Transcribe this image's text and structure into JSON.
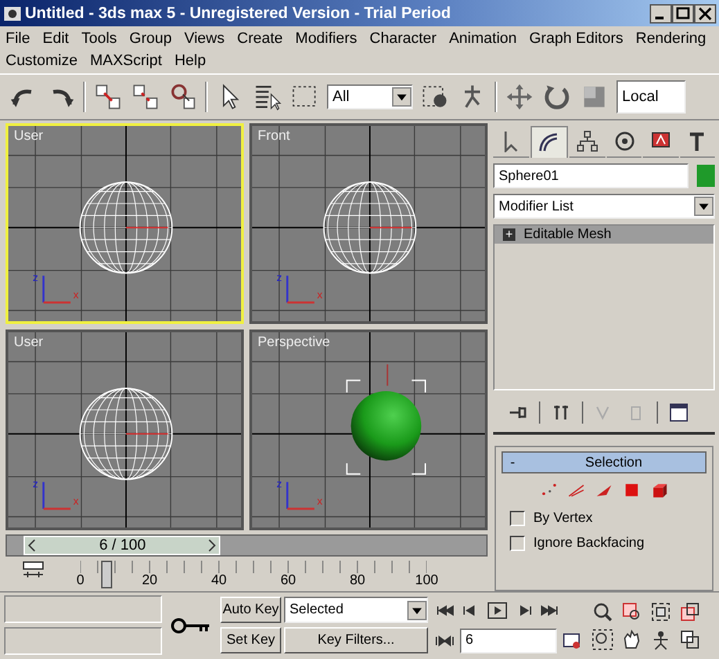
{
  "window": {
    "title": "Untitled - 3ds max 5 - Unregistered Version - Trial Period"
  },
  "menu_rows": [
    [
      "File",
      "Edit",
      "Tools",
      "Group",
      "Views",
      "Create",
      "Modifiers",
      "Character",
      "Animation",
      "Graph Editors",
      "Rendering"
    ],
    [
      "Customize",
      "MAXScript",
      "Help"
    ]
  ],
  "toolbar": {
    "selection_filter": "All",
    "reference_coordinates": "Local"
  },
  "viewports": [
    {
      "label": "User",
      "selected": true,
      "kind": "wire",
      "axes": [
        "z",
        "x"
      ]
    },
    {
      "label": "Front",
      "selected": false,
      "kind": "wire",
      "axes": [
        "z",
        "x"
      ]
    },
    {
      "label": "User",
      "selected": false,
      "kind": "wire",
      "axes": [
        "z",
        "x"
      ]
    },
    {
      "label": "Perspective",
      "selected": false,
      "kind": "shaded",
      "axes": [
        "z",
        "x"
      ]
    }
  ],
  "command_panel": {
    "tabs": [
      {
        "kind": "create",
        "selected": false
      },
      {
        "kind": "modify",
        "selected": true
      },
      {
        "kind": "hierarchy",
        "selected": false
      },
      {
        "kind": "motion",
        "selected": false
      },
      {
        "kind": "display",
        "selected": false
      },
      {
        "kind": "utilities",
        "selected": false
      }
    ],
    "object": {
      "name": "Sphere01",
      "color": "#1f9a2a"
    },
    "modifier_list": "Modifier List",
    "stack": [
      {
        "label": "Editable Mesh",
        "expand_sign": "+"
      }
    ],
    "rollout": {
      "title": "Selection",
      "expand_sign": "-",
      "options": [
        {
          "label": "By Vertex",
          "checked": false
        },
        {
          "label": "Ignore Backfacing",
          "checked": false
        }
      ]
    }
  },
  "time_slider": {
    "label": "6 / 100",
    "level": 0.06,
    "ticks": [
      "0",
      "20",
      "40",
      "60",
      "80",
      "100"
    ]
  },
  "bottom": {
    "auto_key": "Auto Key",
    "set_key": "Set Key",
    "key_mode": "Selected",
    "key_filters": "Key Filters...",
    "frame": "6"
  }
}
